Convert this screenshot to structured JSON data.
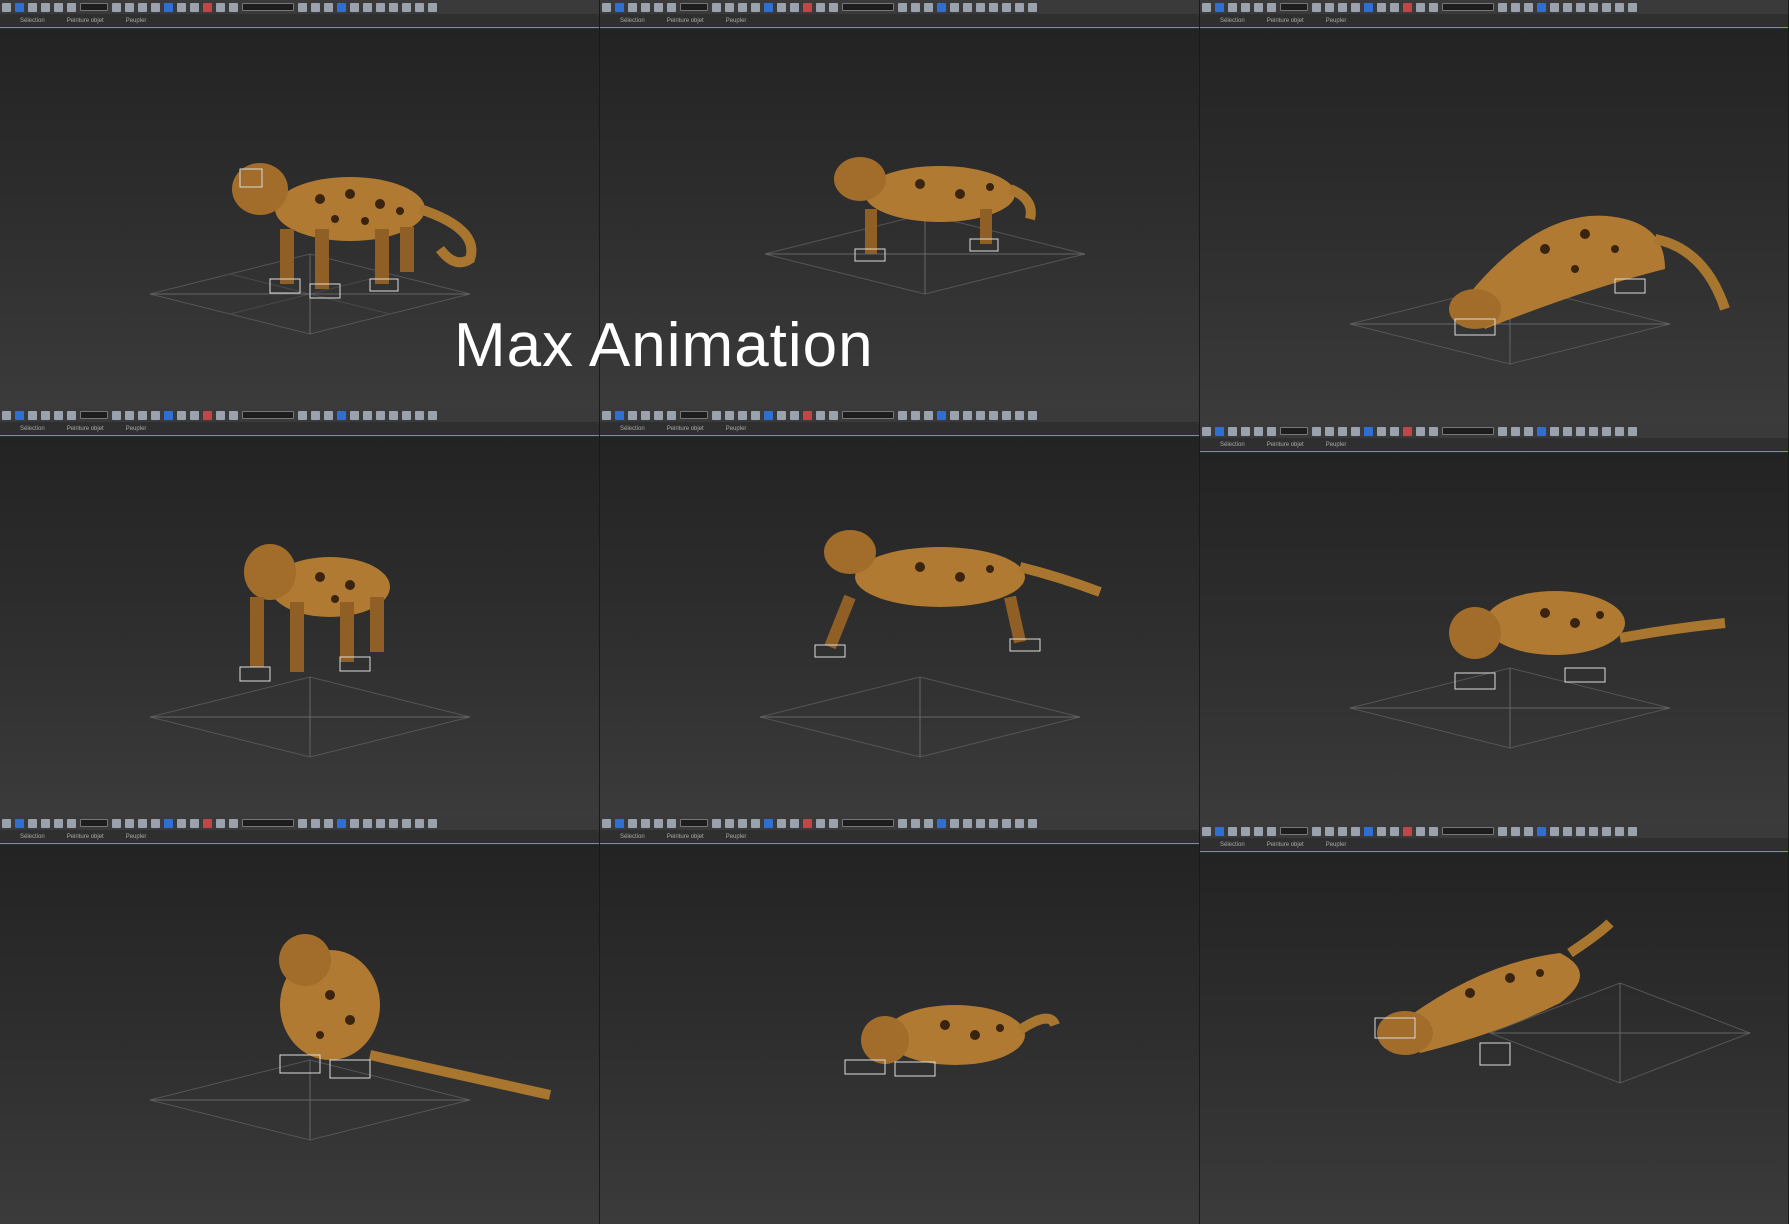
{
  "overlay": {
    "title": "Max Animation"
  },
  "viewport_menu": {
    "items": [
      "Sélection",
      "Peinture objet",
      "Peupler"
    ]
  },
  "icons": [
    "select-icon",
    "select-region-icon",
    "move-icon",
    "rotate-icon",
    "scale-icon",
    "snap-icon",
    "mirror-icon",
    "align-icon",
    "layer-icon",
    "render-icon",
    "teapot-icon"
  ],
  "colors": {
    "viewport_top": "#232323",
    "viewport_bottom": "#3b3b3b",
    "accent_line": "#b08a2e",
    "toolbar": "#3a3a3a"
  },
  "panels": [
    {
      "id": "p1",
      "pose": "stand-walk"
    },
    {
      "id": "p2",
      "pose": "crouch-snarl"
    },
    {
      "id": "p3",
      "pose": "stalk-low"
    },
    {
      "id": "p4",
      "pose": "stand-front"
    },
    {
      "id": "p5",
      "pose": "leap"
    },
    {
      "id": "p6",
      "pose": "crouch-roar"
    },
    {
      "id": "p7",
      "pose": "sit"
    },
    {
      "id": "p8",
      "pose": "lie-down"
    },
    {
      "id": "p9",
      "pose": "pounce"
    }
  ]
}
